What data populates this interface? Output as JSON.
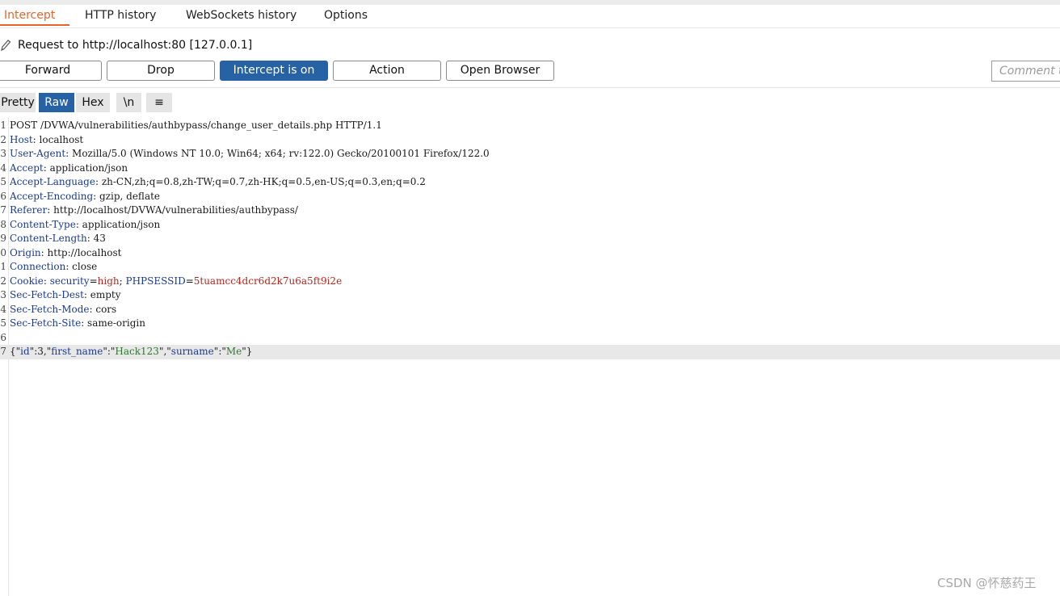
{
  "tabs": [
    {
      "label": "Intercept",
      "active": true
    },
    {
      "label": "HTTP history",
      "active": false
    },
    {
      "label": "WebSockets history",
      "active": false
    },
    {
      "label": "Options",
      "active": false
    }
  ],
  "request_info": "Request to http://localhost:80  [127.0.0.1]",
  "toolbar": {
    "forward": "Forward",
    "drop": "Drop",
    "intercept": "Intercept is on",
    "action": "Action",
    "open_browser": "Open Browser",
    "comment_placeholder": "Comment this item"
  },
  "view": {
    "pretty": "Pretty",
    "raw": "Raw",
    "hex": "Hex",
    "newline": "\\n",
    "menu_icon": "≡",
    "selected": "Raw"
  },
  "request": {
    "request_line": "POST /DVWA/vulnerabilities/authbypass/change_user_details.php HTTP/1.1",
    "headers": [
      {
        "name": "Host",
        "value": "localhost"
      },
      {
        "name": "User-Agent",
        "value": "Mozilla/5.0 (Windows NT 10.0; Win64; x64; rv:122.0) Gecko/20100101 Firefox/122.0"
      },
      {
        "name": "Accept",
        "value": "application/json"
      },
      {
        "name": "Accept-Language",
        "value": "zh-CN,zh;q=0.8,zh-TW;q=0.7,zh-HK;q=0.5,en-US;q=0.3,en;q=0.2"
      },
      {
        "name": "Accept-Encoding",
        "value": "gzip, deflate"
      },
      {
        "name": "Referer",
        "value": "http://localhost/DVWA/vulnerabilities/authbypass/"
      },
      {
        "name": "Content-Type",
        "value": "application/json"
      },
      {
        "name": "Content-Length",
        "value": "43"
      },
      {
        "name": "Origin",
        "value": "http://localhost"
      },
      {
        "name": "Connection",
        "value": "close"
      }
    ],
    "cookies": [
      {
        "name": "security",
        "value": "high"
      },
      {
        "name": "PHPSESSID",
        "value": "5tuamcc4dcr6d2k7u6a5ft9i2e"
      }
    ],
    "headers_after": [
      {
        "name": "Sec-Fetch-Dest",
        "value": "empty"
      },
      {
        "name": "Sec-Fetch-Mode",
        "value": "cors"
      },
      {
        "name": "Sec-Fetch-Site",
        "value": "same-origin"
      }
    ],
    "body": [
      {
        "key": "id",
        "value": "3",
        "quoted": false
      },
      {
        "key": "first_name",
        "value": "Hack123",
        "quoted": true
      },
      {
        "key": "surname",
        "value": "Me",
        "quoted": true
      }
    ]
  },
  "watermark": "CSDN @怀慈药王"
}
